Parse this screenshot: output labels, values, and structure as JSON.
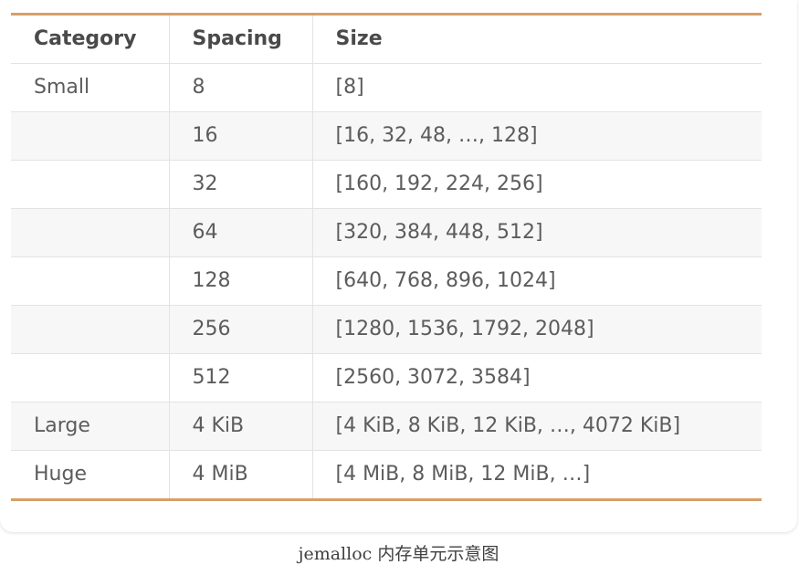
{
  "table": {
    "headers": [
      "Category",
      "Spacing",
      "Size"
    ],
    "rows": [
      [
        "Small",
        "8",
        "[8]"
      ],
      [
        "",
        "16",
        "[16, 32, 48, …, 128]"
      ],
      [
        "",
        "32",
        "[160, 192, 224, 256]"
      ],
      [
        "",
        "64",
        "[320, 384, 448, 512]"
      ],
      [
        "",
        "128",
        "[640, 768, 896, 1024]"
      ],
      [
        "",
        "256",
        "[1280, 1536, 1792, 2048]"
      ],
      [
        "",
        "512",
        "[2560, 3072, 3584]"
      ],
      [
        "Large",
        "4 KiB",
        "[4 KiB, 8 KiB, 12 KiB, …, 4072 KiB]"
      ],
      [
        "Huge",
        "4 MiB",
        "[4 MiB, 8 MiB, 12 MiB, …]"
      ]
    ]
  },
  "caption": "jemalloc 内存单元示意图",
  "colors": {
    "accent_rule": "#d79f67",
    "stripe": "#f7f7f7",
    "grid": "#e3e3e3"
  }
}
